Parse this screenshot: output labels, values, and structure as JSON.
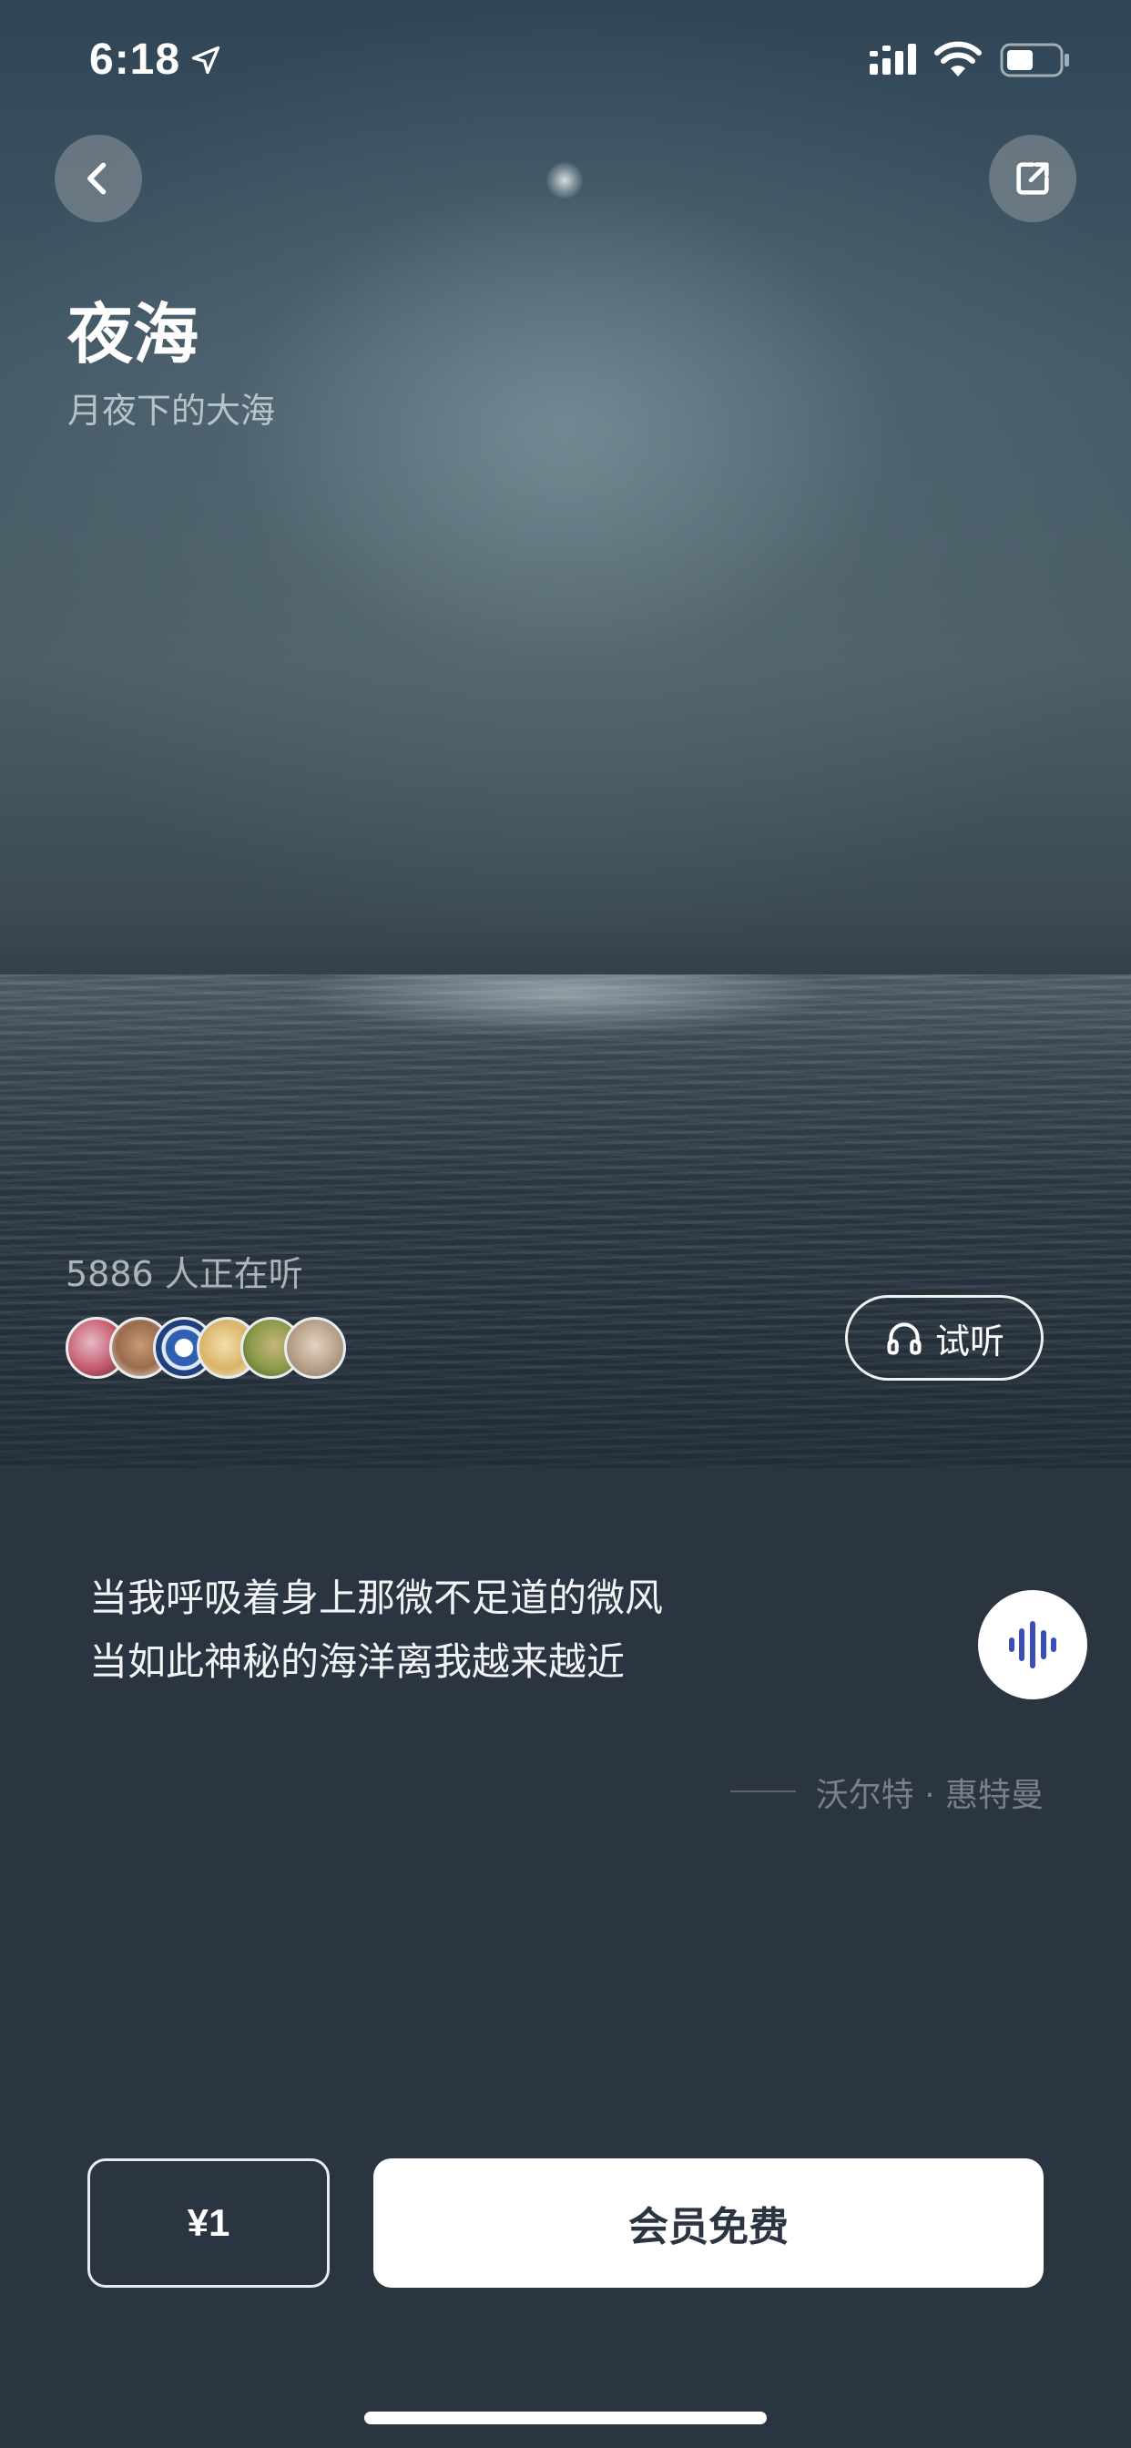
{
  "status_bar": {
    "time": "6:18",
    "icons": [
      "location-arrow-icon",
      "signal-icon",
      "wifi-icon",
      "battery-icon"
    ]
  },
  "header": {
    "back_icon": "chevron-left-icon",
    "share_icon": "share-icon"
  },
  "hero": {
    "title": "夜海",
    "subtitle": "月夜下的大海",
    "listeners_text": "5886 人正在听",
    "avatars": [
      {
        "color": "#c45a6e"
      },
      {
        "color": "#9a6b4e"
      },
      {
        "color": "#2f5fb0"
      },
      {
        "color": "#d9b46a"
      },
      {
        "color": "#8a9a4a"
      },
      {
        "color": "#b8a18a"
      }
    ],
    "trial_button": {
      "label": "试听",
      "icon": "headphones-icon"
    }
  },
  "quote": {
    "lines": [
      "当我呼吸着身上那微不足道的微风",
      "当如此神秘的海洋离我越来越近"
    ],
    "author": "沃尔特 · 惠特曼",
    "voice_icon": "waveform-icon"
  },
  "purchase": {
    "price_label": "¥1",
    "member_label": "会员免费"
  },
  "colors": {
    "background": "#2b3441",
    "accent": "#3a4fb5",
    "button_light": "#ffffff"
  }
}
